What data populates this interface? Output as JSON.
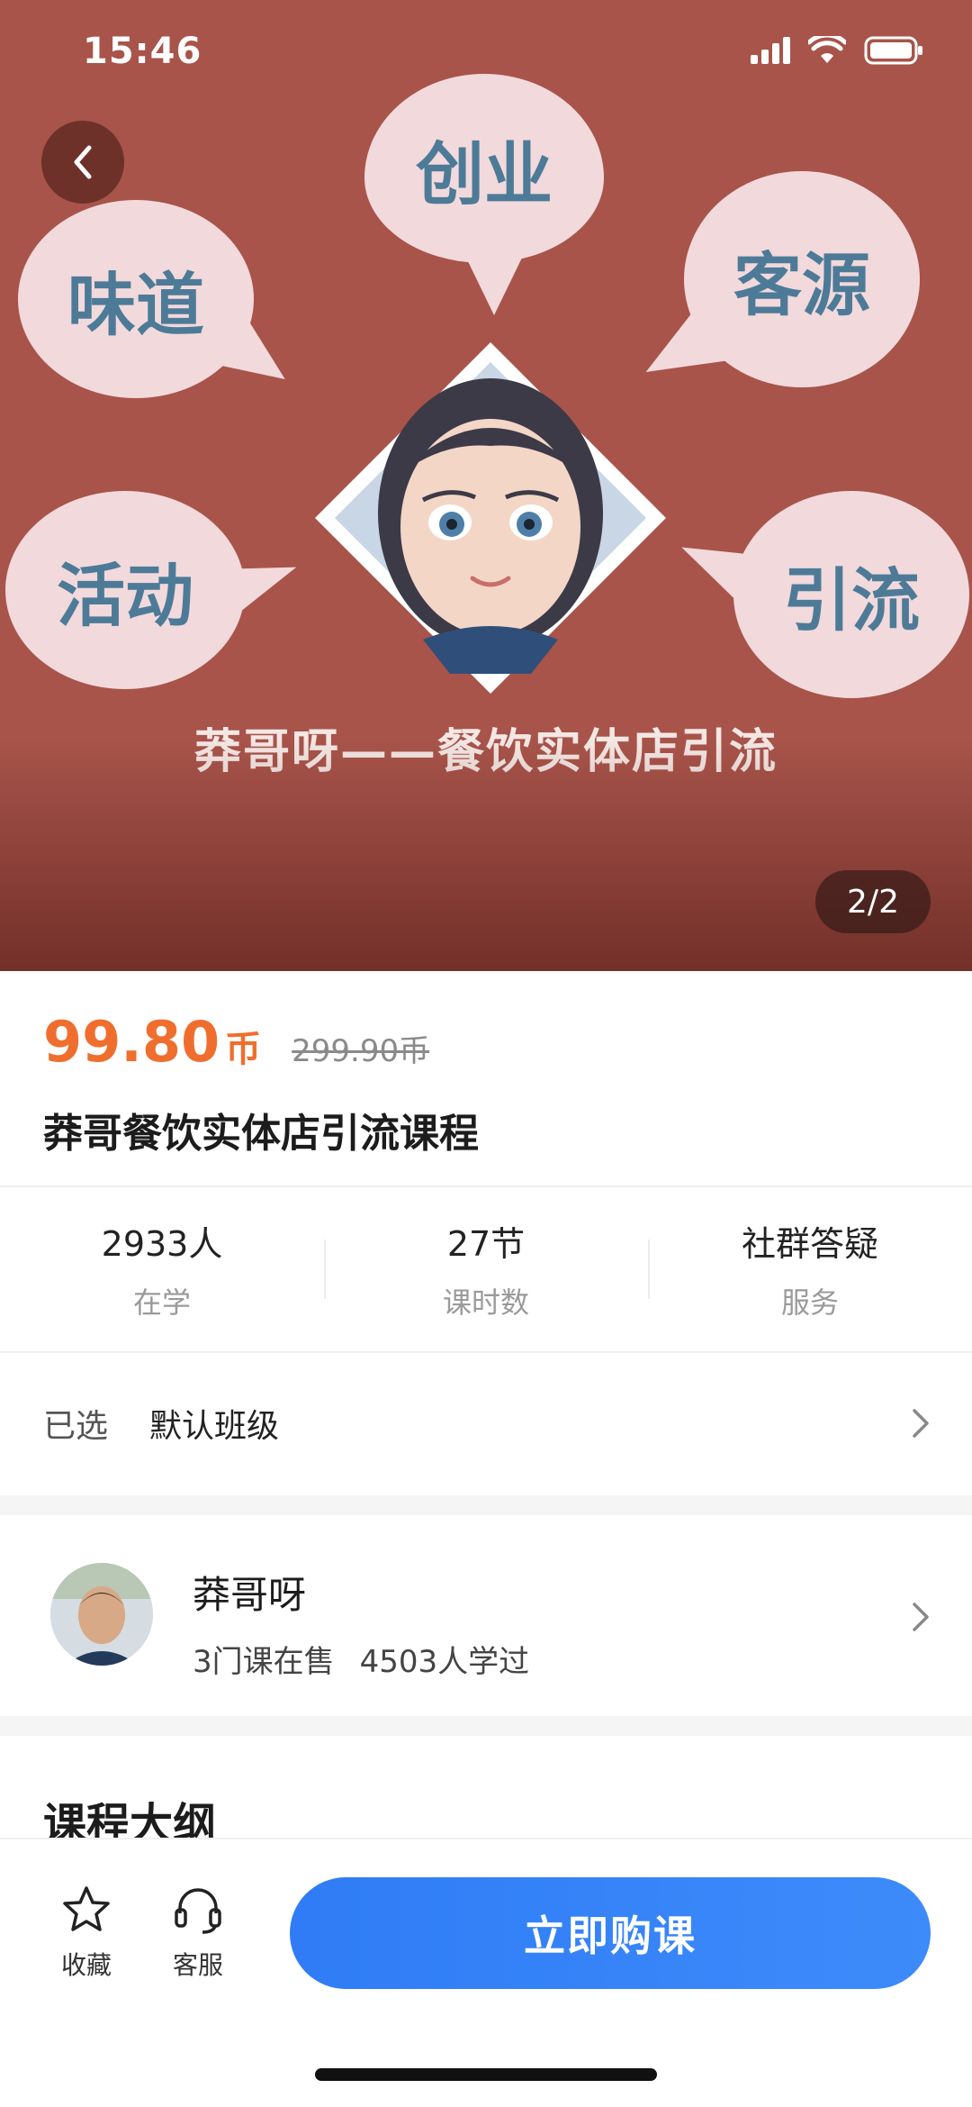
{
  "status_bar": {
    "time": "15:46"
  },
  "hero": {
    "bubbles": [
      "创业",
      "味道",
      "客源",
      "活动",
      "引流"
    ],
    "caption": "莽哥呀——餐饮实体店引流",
    "page_indicator": "2/2"
  },
  "product": {
    "price": "99.80",
    "price_unit": "币",
    "original_price": "299.90币",
    "title": "莽哥餐饮实体店引流课程"
  },
  "stats": [
    {
      "value": "2933人",
      "label": "在学"
    },
    {
      "value": "27节",
      "label": "课时数"
    },
    {
      "value": "社群答疑",
      "label": "服务"
    }
  ],
  "selection": {
    "label": "已选",
    "value": "默认班级"
  },
  "teacher": {
    "name": "莽哥呀",
    "courses": "3门课在售",
    "learners": "4503人学过"
  },
  "syllabus": {
    "title": "课程大纲"
  },
  "bottom_bar": {
    "favorite_label": "收藏",
    "service_label": "客服",
    "buy_label": "立即购课"
  },
  "colors": {
    "accent_price": "#ef6e2e",
    "buy_button": "#2f7cf6",
    "hero_background": "#a8544a"
  },
  "icons": [
    "back-arrow-icon",
    "signal-icon",
    "wifi-icon",
    "battery-icon",
    "chevron-right-icon",
    "star-icon",
    "headset-icon"
  ]
}
